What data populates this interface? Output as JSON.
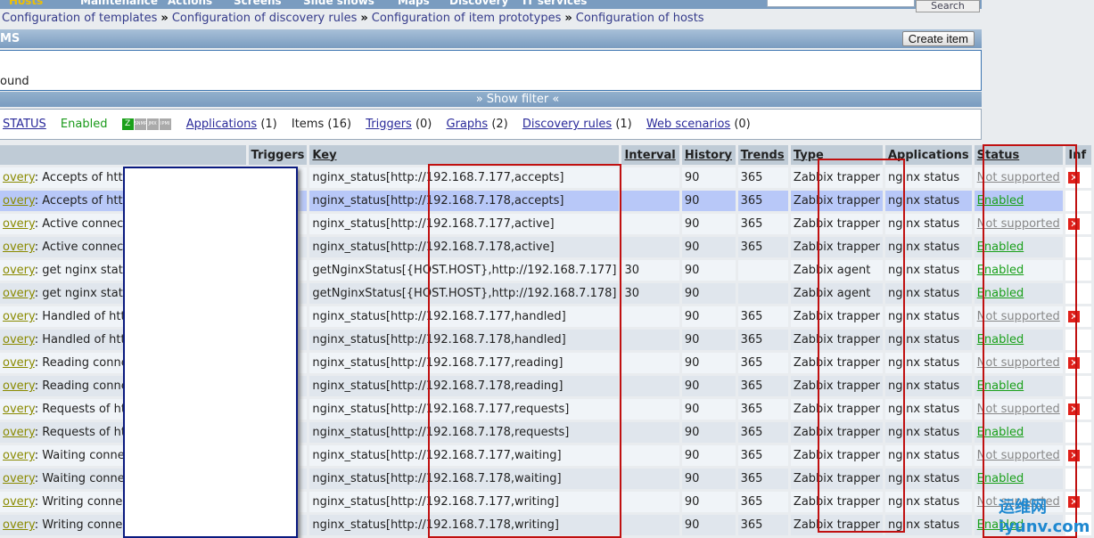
{
  "topnav": {
    "items": [
      "Hosts",
      "Maintenance",
      "Actions",
      "Screens",
      "Slide shows",
      "Maps",
      "Discovery",
      "IT services"
    ],
    "search_button": "Search"
  },
  "breadcrumb": [
    "Configuration of templates",
    "Configuration of discovery rules",
    "Configuration of item prototypes",
    "Configuration of hosts"
  ],
  "breadcrumb_sep": "»",
  "header": {
    "title": "MS",
    "create_button": "Create item"
  },
  "box_text": "ound",
  "filter_label": "» Show filter «",
  "infobar": {
    "host": "STATUS",
    "status": "Enabled",
    "icons": [
      "Z",
      "SNMP",
      "JMX",
      "IPMI"
    ],
    "applications": "Applications",
    "applications_count": "(1)",
    "items": "Items (16)",
    "triggers": "Triggers",
    "triggers_count": "(0)",
    "graphs": "Graphs",
    "graphs_count": "(2)",
    "discovery": "Discovery rules",
    "discovery_count": "(1)",
    "web": "Web scenarios",
    "web_count": "(0)"
  },
  "columns": [
    "",
    "Triggers",
    "Key",
    "Interval",
    "History",
    "Trends",
    "Type",
    "Applications",
    "Status",
    "Inf"
  ],
  "rows": [
    {
      "prefix": "overy",
      "name": ": Accepts of http",
      "key": "nginx_status[http://192.168.7.177,accepts]",
      "interval": "",
      "history": "90",
      "trends": "365",
      "type": "Zabbix trapper",
      "app": "nginx status",
      "status": "Not supported",
      "err": true
    },
    {
      "prefix": "overy",
      "name": ": Accepts of http",
      "key": "nginx_status[http://192.168.7.178,accepts]",
      "interval": "",
      "history": "90",
      "trends": "365",
      "type": "Zabbix trapper",
      "app": "nginx status",
      "status": "Enabled",
      "err": false
    },
    {
      "prefix": "overy",
      "name": ": Active connecti",
      "key": "nginx_status[http://192.168.7.177,active]",
      "interval": "",
      "history": "90",
      "trends": "365",
      "type": "Zabbix trapper",
      "app": "nginx status",
      "status": "Not supported",
      "err": true
    },
    {
      "prefix": "overy",
      "name": ": Active connecti",
      "key": "nginx_status[http://192.168.7.178,active]",
      "interval": "",
      "history": "90",
      "trends": "365",
      "type": "Zabbix trapper",
      "app": "nginx status",
      "status": "Enabled",
      "err": false
    },
    {
      "prefix": "overy",
      "name": ": get nginx statu",
      "key": "getNginxStatus[{HOST.HOST},http://192.168.7.177]",
      "interval": "30",
      "history": "90",
      "trends": "",
      "type": "Zabbix agent",
      "app": "nginx status",
      "status": "Enabled",
      "err": false
    },
    {
      "prefix": "overy",
      "name": ": get nginx statu",
      "key": "getNginxStatus[{HOST.HOST},http://192.168.7.178]",
      "interval": "30",
      "history": "90",
      "trends": "",
      "type": "Zabbix agent",
      "app": "nginx status",
      "status": "Enabled",
      "err": false
    },
    {
      "prefix": "overy",
      "name": ": Handled of http",
      "key": "nginx_status[http://192.168.7.177,handled]",
      "interval": "",
      "history": "90",
      "trends": "365",
      "type": "Zabbix trapper",
      "app": "nginx status",
      "status": "Not supported",
      "err": true
    },
    {
      "prefix": "overy",
      "name": ": Handled of http",
      "key": "nginx_status[http://192.168.7.178,handled]",
      "interval": "",
      "history": "90",
      "trends": "365",
      "type": "Zabbix trapper",
      "app": "nginx status",
      "status": "Enabled",
      "err": false
    },
    {
      "prefix": "overy",
      "name": ": Reading conne",
      "key": "nginx_status[http://192.168.7.177,reading]",
      "interval": "",
      "history": "90",
      "trends": "365",
      "type": "Zabbix trapper",
      "app": "nginx status",
      "status": "Not supported",
      "err": true
    },
    {
      "prefix": "overy",
      "name": ": Reading conne",
      "key": "nginx_status[http://192.168.7.178,reading]",
      "interval": "",
      "history": "90",
      "trends": "365",
      "type": "Zabbix trapper",
      "app": "nginx status",
      "status": "Enabled",
      "err": false
    },
    {
      "prefix": "overy",
      "name": ": Requests of ht",
      "key": "nginx_status[http://192.168.7.177,requests]",
      "interval": "",
      "history": "90",
      "trends": "365",
      "type": "Zabbix trapper",
      "app": "nginx status",
      "status": "Not supported",
      "err": true
    },
    {
      "prefix": "overy",
      "name": ": Requests of ht",
      "key": "nginx_status[http://192.168.7.178,requests]",
      "interval": "",
      "history": "90",
      "trends": "365",
      "type": "Zabbix trapper",
      "app": "nginx status",
      "status": "Enabled",
      "err": false
    },
    {
      "prefix": "overy",
      "name": ": Waiting conne",
      "key": "nginx_status[http://192.168.7.177,waiting]",
      "interval": "",
      "history": "90",
      "trends": "365",
      "type": "Zabbix trapper",
      "app": "nginx status",
      "status": "Not supported",
      "err": true
    },
    {
      "prefix": "overy",
      "name": ": Waiting conne",
      "key": "nginx_status[http://192.168.7.178,waiting]",
      "interval": "",
      "history": "90",
      "trends": "365",
      "type": "Zabbix trapper",
      "app": "nginx status",
      "status": "Enabled",
      "err": false
    },
    {
      "prefix": "overy",
      "name": ": Writing conne",
      "key": "nginx_status[http://192.168.7.177,writing]",
      "interval": "",
      "history": "90",
      "trends": "365",
      "type": "Zabbix trapper",
      "app": "nginx status",
      "status": "Not supported",
      "err": true
    },
    {
      "prefix": "overy",
      "name": ": Writing conne",
      "key": "nginx_status[http://192.168.7.178,writing]",
      "interval": "",
      "history": "90",
      "trends": "365",
      "type": "Zabbix trapper",
      "app": "nginx status",
      "status": "Enabled",
      "err": false
    }
  ],
  "error_icon": "✕",
  "watermark": "运维网 iyunv.com"
}
